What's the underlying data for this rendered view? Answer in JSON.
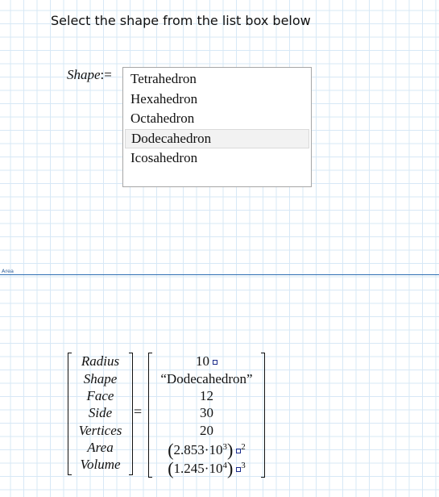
{
  "instruction": "Select the shape from the list box below",
  "shape_label": "Shape",
  "assign_op": ":=",
  "listbox": {
    "items": [
      "Tetrahedron",
      "Hexahedron",
      "Octahedron",
      "Dodecahedron",
      "Icosahedron"
    ],
    "selected": "Dodecahedron"
  },
  "region_label": "Area",
  "result": {
    "equals": "=",
    "names": [
      "Radius",
      "Shape",
      "Face",
      "Side",
      "Vertices",
      "Area",
      "Volume"
    ],
    "values": {
      "radius": "10",
      "shape": "“Dodecahedron”",
      "face": "12",
      "side": "30",
      "vertices": "20",
      "area_mantissa": "2.853",
      "area_exponent": "3",
      "area_unit_power": "2",
      "volume_mantissa": "1.245",
      "volume_exponent": "4",
      "volume_unit_power": "3",
      "times_ten": "10",
      "dot": "·"
    }
  }
}
